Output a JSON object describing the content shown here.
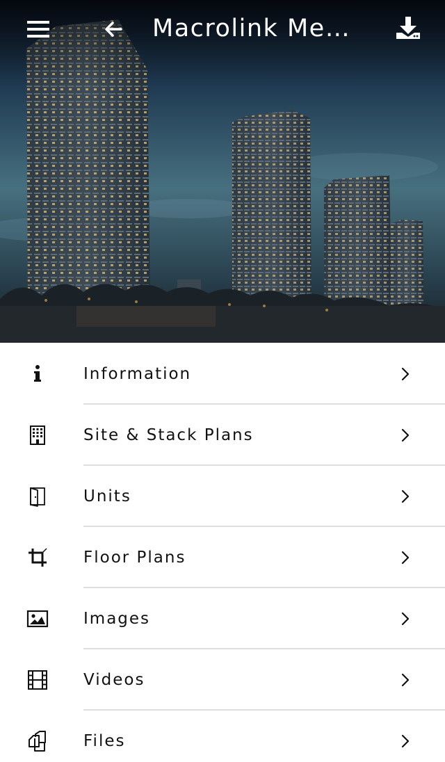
{
  "header": {
    "title": "Macrolink Medi..."
  },
  "menu": {
    "items": [
      {
        "label": "Information",
        "icon": "info-icon"
      },
      {
        "label": "Site & Stack Plans",
        "icon": "building-icon"
      },
      {
        "label": "Units",
        "icon": "door-icon"
      },
      {
        "label": "Floor Plans",
        "icon": "crop-icon"
      },
      {
        "label": "Images",
        "icon": "image-icon"
      },
      {
        "label": "Videos",
        "icon": "film-icon"
      },
      {
        "label": "Files",
        "icon": "files-icon"
      }
    ]
  },
  "colors": {
    "header_text": "#ffffff",
    "label_text": "#111111",
    "divider": "#dddddd",
    "sky_top": "#0c1624",
    "sky_mid": "#3d6478"
  }
}
